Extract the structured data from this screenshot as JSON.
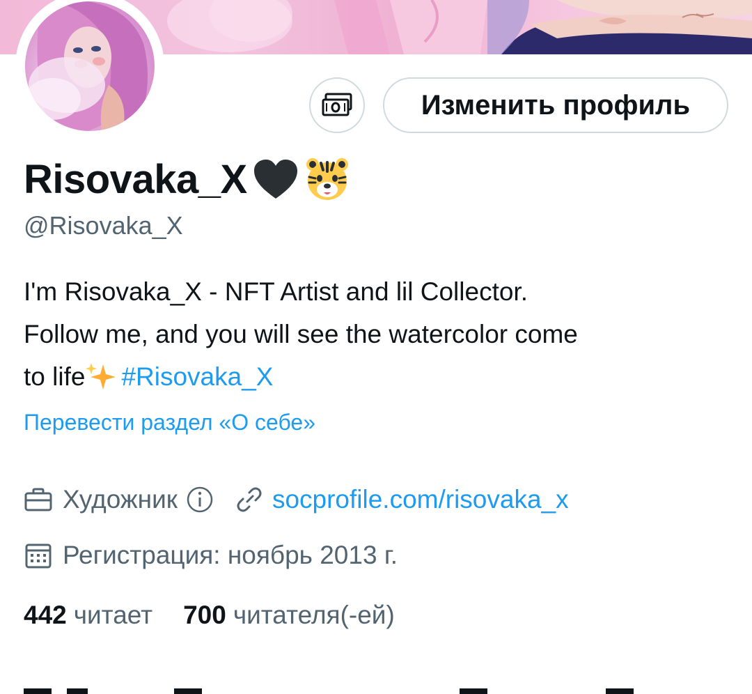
{
  "profile": {
    "display_name": "Risovaka_X",
    "handle": "@Risovaka_X",
    "bio_line1": "I'm Risovaka_X - NFT Artist and lil Collector.",
    "bio_line2": "Follow me, and you will see the watercolor come",
    "bio_line3_prefix": "to life",
    "bio_hashtag": "#Risovaka_X",
    "translate_link": "Перевести раздел «О себе»",
    "category": "Художник",
    "website": "socprofile.com/risovaka_x",
    "joined": "Регистрация: ноябрь 2013 г."
  },
  "actions": {
    "edit_profile_label": "Изменить профиль",
    "tip_icon": "money-icon"
  },
  "stats": {
    "following_count": "442",
    "following_label": "читает",
    "followers_count": "700",
    "followers_label": "читателя(-ей)"
  },
  "colors": {
    "accent": "#1d9bf0",
    "text": "#0f1419",
    "secondary": "#536471",
    "border": "#cfd9de"
  },
  "icons": [
    "heart-icon",
    "tiger-emoji-icon",
    "sparkles-icon",
    "briefcase-icon",
    "info-icon",
    "link-icon",
    "calendar-icon",
    "money-icon"
  ]
}
